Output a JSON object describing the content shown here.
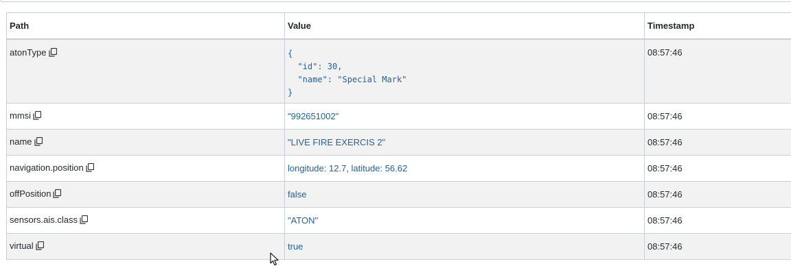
{
  "table": {
    "headers": {
      "path": "Path",
      "value": "Value",
      "timestamp": "Timestamp"
    },
    "rows": [
      {
        "path": "atonType",
        "value_lines": [
          "{",
          "  \"id\": 30,",
          "  \"name\": \"Special Mark\"",
          "}"
        ],
        "value_format": "json",
        "timestamp": "08:57:46"
      },
      {
        "path": "mmsi",
        "value": "\"992651002\"",
        "timestamp": "08:57:46"
      },
      {
        "path": "name",
        "value": "\"LIVE FIRE EXERCIS 2\"",
        "timestamp": "08:57:46"
      },
      {
        "path": "navigation.position",
        "value": "longitude: 12.7, latitude: 56.62",
        "timestamp": "08:57:46"
      },
      {
        "path": "offPosition",
        "value": "false",
        "timestamp": "08:57:46"
      },
      {
        "path": "sensors.ais.class",
        "value": "\"ATON\"",
        "timestamp": "08:57:46"
      },
      {
        "path": "virtual",
        "value": "true",
        "timestamp": "08:57:46"
      }
    ]
  },
  "icons": {
    "copy": "copy-icon",
    "cursor": "mouse-pointer-icon"
  },
  "colors": {
    "value_text": "#20639b",
    "border": "#c8ced3",
    "stripe": "#f2f2f2"
  }
}
